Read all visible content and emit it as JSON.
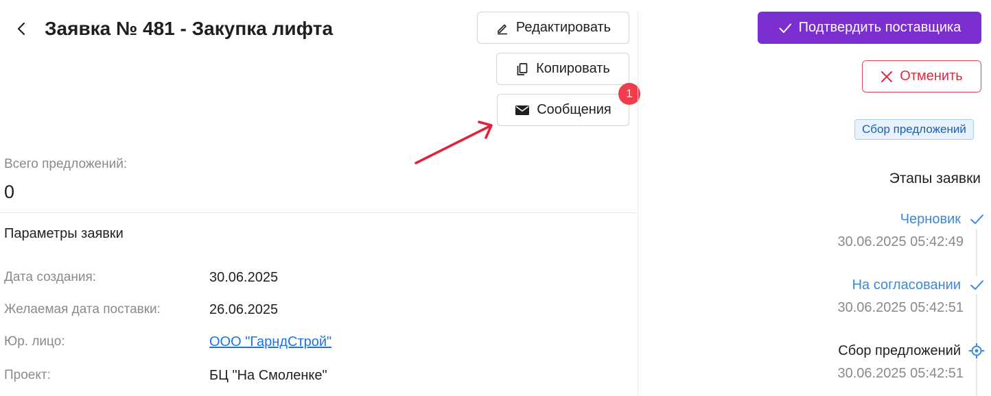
{
  "header": {
    "title": "Заявка № 481 - Закупка лифта"
  },
  "toolbar": {
    "edit_label": "Редактировать",
    "copy_label": "Копировать",
    "messages_label": "Сообщения",
    "messages_badge": "1"
  },
  "summary": {
    "total_label": "Всего предложений:",
    "total_value": "0"
  },
  "params": {
    "title": "Параметры заявки",
    "rows": [
      {
        "label": "Дата создания:",
        "value": "30.06.2025"
      },
      {
        "label": "Желаемая дата поставки:",
        "value": "26.06.2025"
      },
      {
        "label": "Юр. лицо:",
        "value": "ООО \"ГарндСтрой\""
      },
      {
        "label": "Проект:",
        "value": "БЦ \"На Смоленке\""
      }
    ]
  },
  "actions": {
    "confirm_label": "Подтвердить поставщика",
    "cancel_label": "Отменить"
  },
  "status": {
    "label": "Сбор предложений"
  },
  "stages": {
    "title": "Этапы заявки",
    "items": [
      {
        "name": "Черновик",
        "time": "30.06.2025 05:42:49",
        "state": "done",
        "icon": "check-icon"
      },
      {
        "name": "На согласовании",
        "time": "30.06.2025 05:42:51",
        "state": "done",
        "icon": "check-icon"
      },
      {
        "name": "Сбор предложений",
        "time": "30.06.2025 05:42:51",
        "state": "current",
        "icon": "target-icon"
      }
    ]
  },
  "colors": {
    "primary": "#7b2fd0",
    "danger": "#e0293e",
    "badge": "#f03d4e",
    "link": "#1a73e8",
    "stage_done": "#3d87d8",
    "annotation_arrow": "#e0223a"
  }
}
